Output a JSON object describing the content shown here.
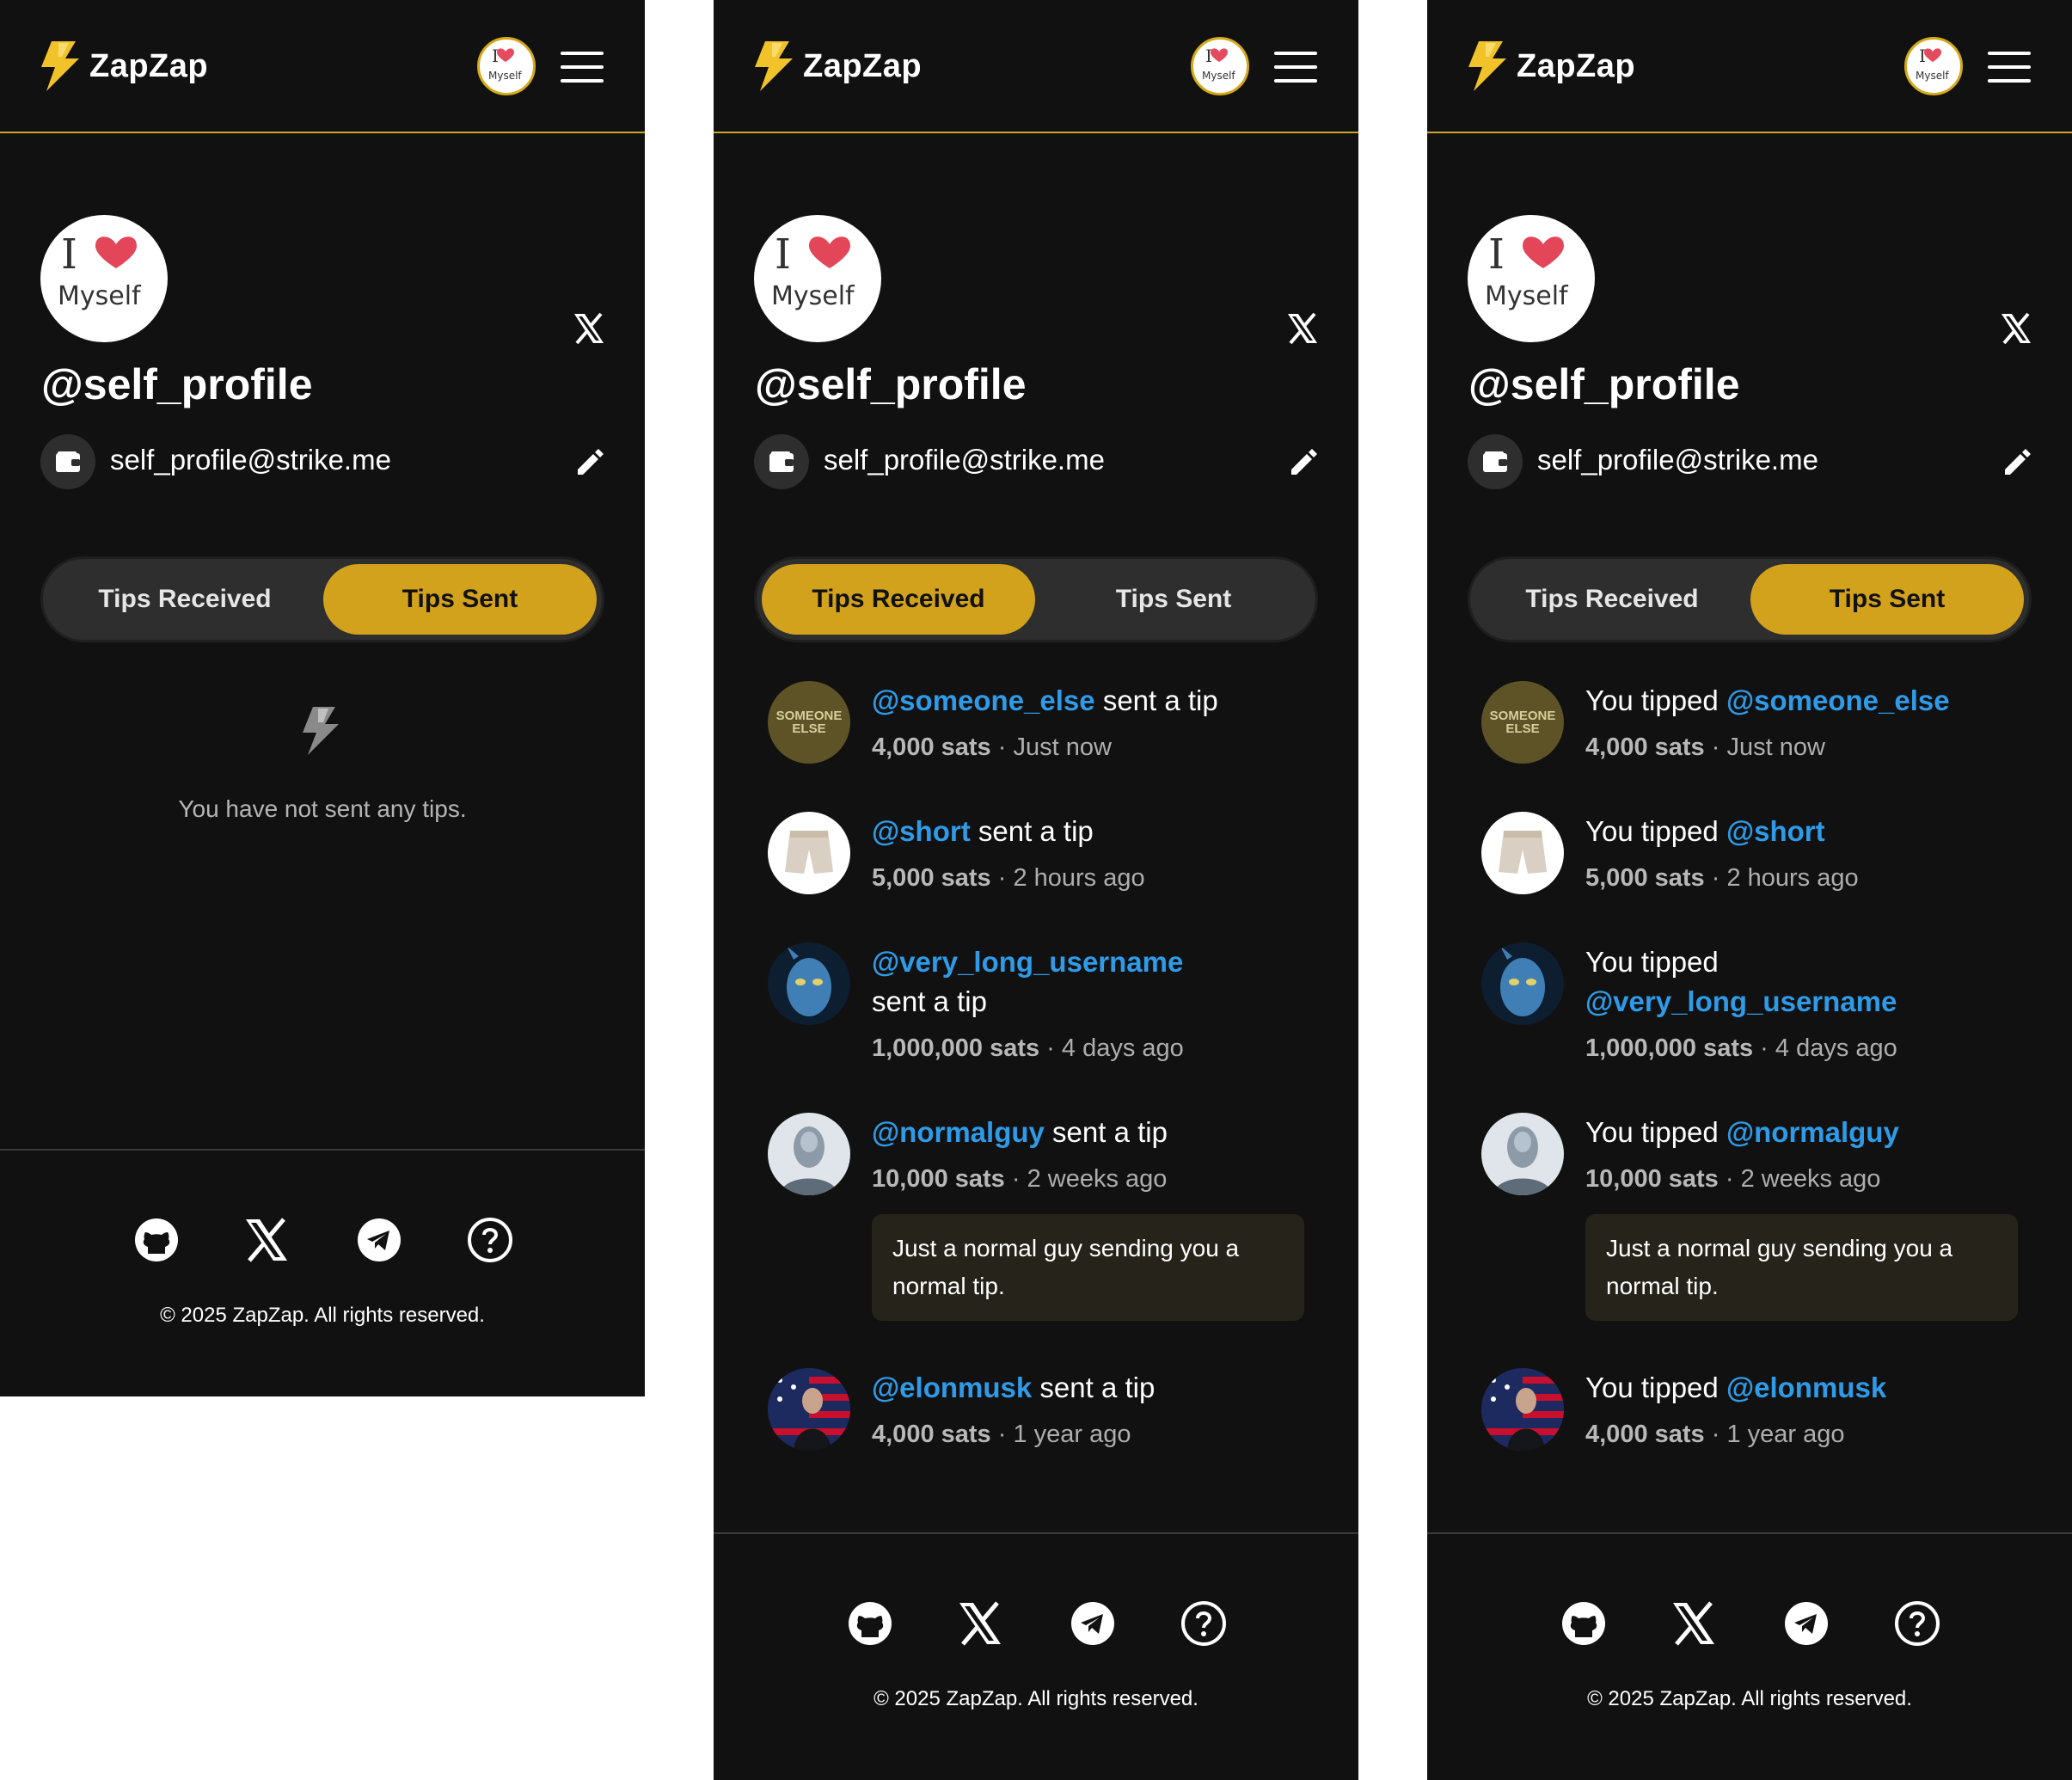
{
  "app": {
    "name": "ZapZap"
  },
  "profile": {
    "handle": "@self_profile",
    "wallet": "self_profile@strike.me",
    "avatar_lines": [
      "I",
      "Myself"
    ]
  },
  "tabs": {
    "received": "Tips Received",
    "sent": "Tips Sent"
  },
  "panels": [
    {
      "active_tab": "sent",
      "state": "empty",
      "empty_message": "You have not sent any tips."
    },
    {
      "active_tab": "received",
      "state": "list"
    },
    {
      "active_tab": "sent",
      "state": "list"
    }
  ],
  "received_tips": [
    {
      "user": "@someone_else",
      "suffix": "sent a tip",
      "amount": "4,000 sats",
      "time": "Just now",
      "avatar": "someone-else-avatar",
      "avatar_text": "SOMEONE ELSE"
    },
    {
      "user": "@short",
      "suffix": "sent a tip",
      "amount": "5,000 sats",
      "time": "2 hours ago",
      "avatar": "shorts-avatar"
    },
    {
      "user": "@very_long_username",
      "suffix": "sent a tip",
      "amount": "1,000,000 sats",
      "time": "4 days ago",
      "avatar": "blue-alien-avatar"
    },
    {
      "user": "@normalguy",
      "suffix": "sent a tip",
      "amount": "10,000 sats",
      "time": "2 weeks ago",
      "avatar": "humanoid-avatar",
      "note": "Just a normal guy sending you a normal tip."
    },
    {
      "user": "@elonmusk",
      "suffix": "sent a tip",
      "amount": "4,000 sats",
      "time": "1 year ago",
      "avatar": "flag-avatar"
    }
  ],
  "sent_tips": [
    {
      "prefix": "You tipped",
      "user": "@someone_else",
      "amount": "4,000 sats",
      "time": "Just now",
      "avatar": "someone-else-avatar",
      "avatar_text": "SOMEONE ELSE"
    },
    {
      "prefix": "You tipped",
      "user": "@short",
      "amount": "5,000 sats",
      "time": "2 hours ago",
      "avatar": "shorts-avatar"
    },
    {
      "prefix": "You tipped",
      "user": "@very_long_username",
      "amount": "1,000,000 sats",
      "time": "4 days ago",
      "avatar": "blue-alien-avatar"
    },
    {
      "prefix": "You tipped",
      "user": "@normalguy",
      "amount": "10,000 sats",
      "time": "2 weeks ago",
      "avatar": "humanoid-avatar",
      "note": "Just a normal guy sending you a normal tip."
    },
    {
      "prefix": "You tipped",
      "user": "@elonmusk",
      "amount": "4,000 sats",
      "time": "1 year ago",
      "avatar": "flag-avatar"
    }
  ],
  "footer": {
    "icons": [
      "github-icon",
      "x-icon",
      "telegram-icon",
      "help-icon"
    ],
    "copyright": "© 2025 ZapZap. All rights reserved."
  },
  "colors": {
    "accent": "#d3a21c",
    "username": "#2f9be8",
    "background": "#111111",
    "tab_track": "#2e2e2e",
    "note_bg": "#26231a"
  }
}
